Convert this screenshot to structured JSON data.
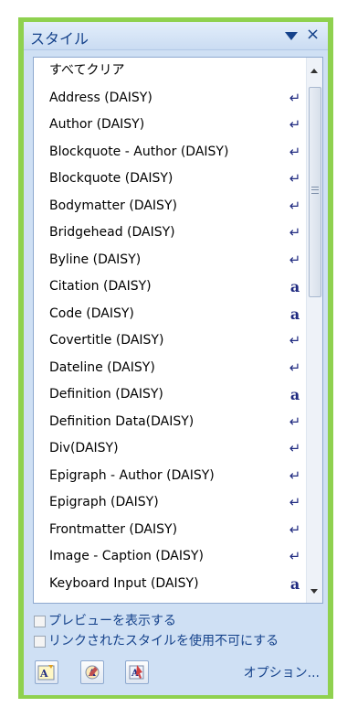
{
  "pane": {
    "title": "スタイル",
    "icons": [
      "dropdown-icon",
      "close-icon"
    ],
    "close_glyph": "×"
  },
  "styles": [
    {
      "label": "すべてクリア",
      "type": "none"
    },
    {
      "label": "Address (DAISY)",
      "type": "paragraph"
    },
    {
      "label": "Author (DAISY)",
      "type": "paragraph"
    },
    {
      "label": "Blockquote - Author (DAISY)",
      "type": "paragraph"
    },
    {
      "label": "Blockquote (DAISY)",
      "type": "paragraph"
    },
    {
      "label": "Bodymatter (DAISY)",
      "type": "paragraph"
    },
    {
      "label": "Bridgehead (DAISY)",
      "type": "paragraph"
    },
    {
      "label": "Byline (DAISY)",
      "type": "paragraph"
    },
    {
      "label": "Citation (DAISY)",
      "type": "character"
    },
    {
      "label": "Code (DAISY)",
      "type": "character"
    },
    {
      "label": "Covertitle (DAISY)",
      "type": "paragraph"
    },
    {
      "label": "Dateline (DAISY)",
      "type": "paragraph"
    },
    {
      "label": "Definition (DAISY)",
      "type": "character"
    },
    {
      "label": "Definition Data(DAISY)",
      "type": "paragraph"
    },
    {
      "label": "Div(DAISY)",
      "type": "paragraph"
    },
    {
      "label": "Epigraph - Author (DAISY)",
      "type": "paragraph"
    },
    {
      "label": "Epigraph (DAISY)",
      "type": "paragraph"
    },
    {
      "label": "Frontmatter (DAISY)",
      "type": "paragraph"
    },
    {
      "label": "Image - Caption (DAISY)",
      "type": "paragraph"
    },
    {
      "label": "Keyboard Input (DAISY)",
      "type": "character"
    }
  ],
  "type_glyphs": {
    "paragraph": "↵",
    "character": "a"
  },
  "checkboxes": {
    "show_preview": "プレビューを表示する",
    "disable_linked": "リンクされたスタイルを使用不可にする"
  },
  "toolbar": {
    "icons": [
      "new-style-icon",
      "style-inspector-icon",
      "manage-styles-icon"
    ],
    "options_label": "オプション..."
  },
  "colors": {
    "accent": "#15428b",
    "border_highlight": "#8fd14f",
    "pane_background": "#cfe0f4",
    "style_type_glyph": "#1f2a80"
  }
}
